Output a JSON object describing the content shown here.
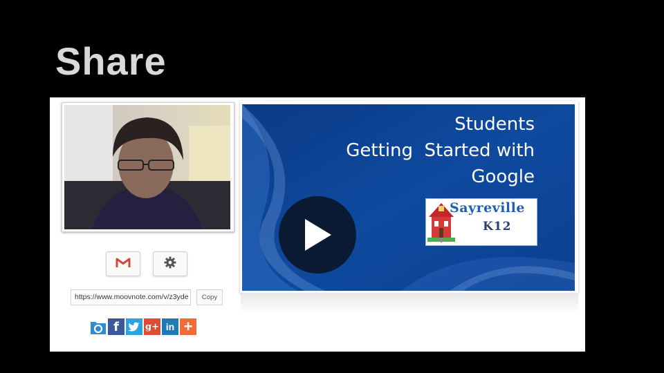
{
  "slide": {
    "title": "Share"
  },
  "share": {
    "gmail_icon": "gmail-m-icon",
    "settings_icon": "gear-icon",
    "url_value": "https://www.moovnote.com/v/z3yde",
    "copy_label": "Copy",
    "social_icons": [
      "folder-icon",
      "facebook-icon",
      "twitter-icon",
      "google-plus-icon",
      "linkedin-icon",
      "plus-icon"
    ],
    "social_glyphs": {
      "facebook": "f",
      "twitter": "t",
      "googleplus": "g+",
      "linkedin": "in",
      "more": "+"
    }
  },
  "video": {
    "title_lines": [
      "Students",
      "Getting  Started with",
      "Google"
    ],
    "play_icon": "play-icon",
    "logo_name": "Sayreville",
    "logo_sub": "K12",
    "background_color": "#0c3f8c"
  },
  "colors": {
    "gmail_red": "#d14836",
    "folder_blue": "#2f8bd5",
    "facebook": "#3b5998",
    "twitter": "#2aa3e0",
    "googleplus": "#dd4b39",
    "linkedin": "#1e7bb5",
    "more": "#f26b3a"
  }
}
